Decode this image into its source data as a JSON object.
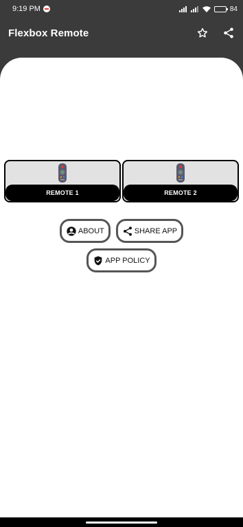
{
  "status": {
    "time": "9:19 PM",
    "battery": "84",
    "battery_level": 0.84
  },
  "appbar": {
    "title": "Flexbox Remote",
    "icons": [
      "star-outline-icon",
      "share-icon"
    ]
  },
  "remotes": [
    {
      "label": "REMOTE 1",
      "icon": "remote-control-icon"
    },
    {
      "label": "REMOTE 2",
      "icon": "remote-control-icon"
    }
  ],
  "buttons": {
    "about": {
      "label": "ABOUT",
      "icon": "account-circle-icon"
    },
    "share": {
      "label": "SHARE APP",
      "icon": "share-icon"
    },
    "policy": {
      "label": "APP POLICY",
      "icon": "shield-check-icon"
    }
  },
  "colors": {
    "bar_background": "#3b3b3b",
    "content_background": "#ffffff",
    "card_background": "#e2e2e2",
    "label_background": "#000000",
    "pill_border": "#555555"
  }
}
